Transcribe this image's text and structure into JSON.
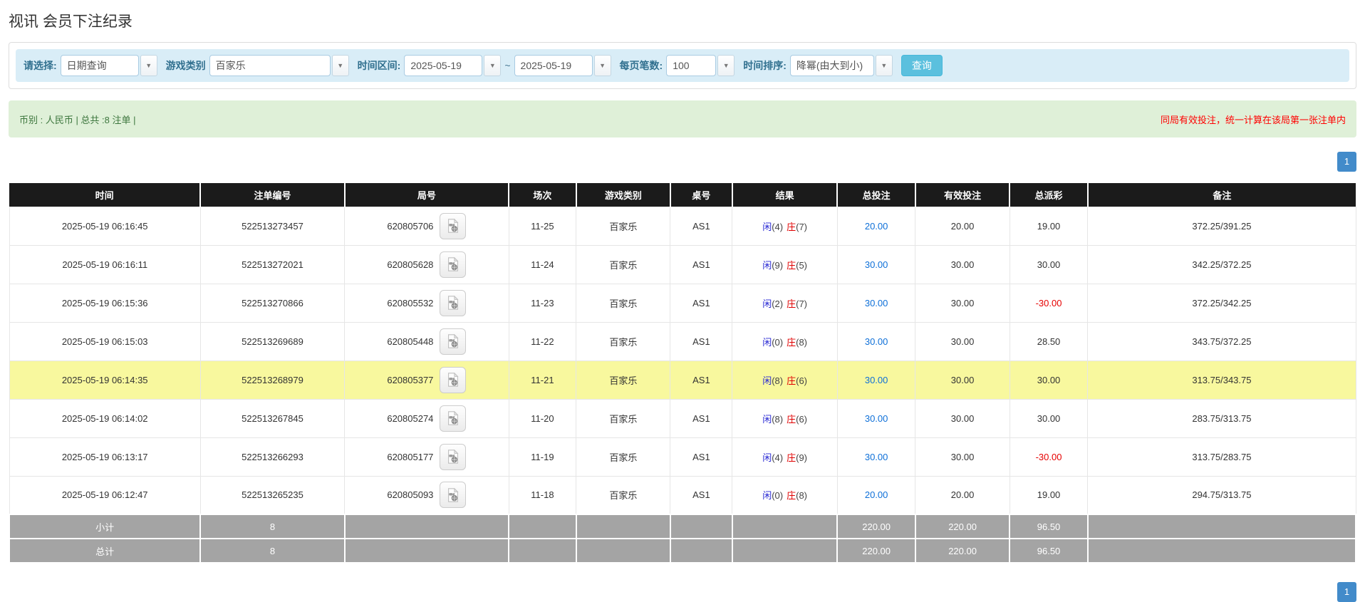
{
  "title": "视讯 会员下注纪录",
  "filters": {
    "query_type_label": "请选择:",
    "query_type_value": "日期查询",
    "game_type_label": "游戏类别",
    "game_type_value": "百家乐",
    "time_range_label": "时间区间:",
    "time_from": "2025-05-19",
    "range_separator": "~",
    "time_to": "2025-05-19",
    "page_size_label": "每页笔数:",
    "page_size_value": "100",
    "sort_label": "时间排序:",
    "sort_value": "降幂(由大到小)",
    "search_button": "查询"
  },
  "summary": {
    "left": "币别 : 人民币 | 总共 :8 注单 |",
    "note": "同局有效投注，统一计算在该局第一张注单内"
  },
  "pagination": {
    "page": "1"
  },
  "colors": {
    "accent": "#5bc0de",
    "link_blue": "#0d6fd8",
    "player_blue": "#2a2ad4",
    "banker_red": "#e00000",
    "negative_red": "#e60000",
    "highlight_yellow": "#f8f89e",
    "header_black": "#1b1b1b",
    "footer_gray": "#a4a4a4"
  },
  "icons": {
    "video_replay": "video-record-icon",
    "dropdown": "chevron-down-icon"
  },
  "table": {
    "columns": [
      "时间",
      "注单编号",
      "局号",
      "场次",
      "游戏类别",
      "桌号",
      "结果",
      "总投注",
      "有效投注",
      "总派彩",
      "备注"
    ],
    "rows": [
      {
        "time": "2025-05-19 06:16:45",
        "bet_id": "522513273457",
        "round_id": "620805706",
        "session": "11-25",
        "game": "百家乐",
        "table_no": "AS1",
        "player_label": "闲",
        "player_score": "(4)",
        "banker_label": "庄",
        "banker_score": "(7)",
        "total_bet": "20.00",
        "valid_bet": "20.00",
        "payout": "19.00",
        "remark": "372.25/391.25",
        "highlight": false
      },
      {
        "time": "2025-05-19 06:16:11",
        "bet_id": "522513272021",
        "round_id": "620805628",
        "session": "11-24",
        "game": "百家乐",
        "table_no": "AS1",
        "player_label": "闲",
        "player_score": "(9)",
        "banker_label": "庄",
        "banker_score": "(5)",
        "total_bet": "30.00",
        "valid_bet": "30.00",
        "payout": "30.00",
        "remark": "342.25/372.25",
        "highlight": false
      },
      {
        "time": "2025-05-19 06:15:36",
        "bet_id": "522513270866",
        "round_id": "620805532",
        "session": "11-23",
        "game": "百家乐",
        "table_no": "AS1",
        "player_label": "闲",
        "player_score": "(2)",
        "banker_label": "庄",
        "banker_score": "(7)",
        "total_bet": "30.00",
        "valid_bet": "30.00",
        "payout": "-30.00",
        "remark": "372.25/342.25",
        "highlight": false
      },
      {
        "time": "2025-05-19 06:15:03",
        "bet_id": "522513269689",
        "round_id": "620805448",
        "session": "11-22",
        "game": "百家乐",
        "table_no": "AS1",
        "player_label": "闲",
        "player_score": "(0)",
        "banker_label": "庄",
        "banker_score": "(8)",
        "total_bet": "30.00",
        "valid_bet": "30.00",
        "payout": "28.50",
        "remark": "343.75/372.25",
        "highlight": false
      },
      {
        "time": "2025-05-19 06:14:35",
        "bet_id": "522513268979",
        "round_id": "620805377",
        "session": "11-21",
        "game": "百家乐",
        "table_no": "AS1",
        "player_label": "闲",
        "player_score": "(8)",
        "banker_label": "庄",
        "banker_score": "(6)",
        "total_bet": "30.00",
        "valid_bet": "30.00",
        "payout": "30.00",
        "remark": "313.75/343.75",
        "highlight": true
      },
      {
        "time": "2025-05-19 06:14:02",
        "bet_id": "522513267845",
        "round_id": "620805274",
        "session": "11-20",
        "game": "百家乐",
        "table_no": "AS1",
        "player_label": "闲",
        "player_score": "(8)",
        "banker_label": "庄",
        "banker_score": "(6)",
        "total_bet": "30.00",
        "valid_bet": "30.00",
        "payout": "30.00",
        "remark": "283.75/313.75",
        "highlight": false
      },
      {
        "time": "2025-05-19 06:13:17",
        "bet_id": "522513266293",
        "round_id": "620805177",
        "session": "11-19",
        "game": "百家乐",
        "table_no": "AS1",
        "player_label": "闲",
        "player_score": "(4)",
        "banker_label": "庄",
        "banker_score": "(9)",
        "total_bet": "30.00",
        "valid_bet": "30.00",
        "payout": "-30.00",
        "remark": "313.75/283.75",
        "highlight": false
      },
      {
        "time": "2025-05-19 06:12:47",
        "bet_id": "522513265235",
        "round_id": "620805093",
        "session": "11-18",
        "game": "百家乐",
        "table_no": "AS1",
        "player_label": "闲",
        "player_score": "(0)",
        "banker_label": "庄",
        "banker_score": "(8)",
        "total_bet": "20.00",
        "valid_bet": "20.00",
        "payout": "19.00",
        "remark": "294.75/313.75",
        "highlight": false
      }
    ],
    "subtotal": {
      "label": "小计",
      "count": "8",
      "total_bet": "220.00",
      "valid_bet": "220.00",
      "payout": "96.50"
    },
    "total": {
      "label": "总计",
      "count": "8",
      "total_bet": "220.00",
      "valid_bet": "220.00",
      "payout": "96.50"
    }
  }
}
